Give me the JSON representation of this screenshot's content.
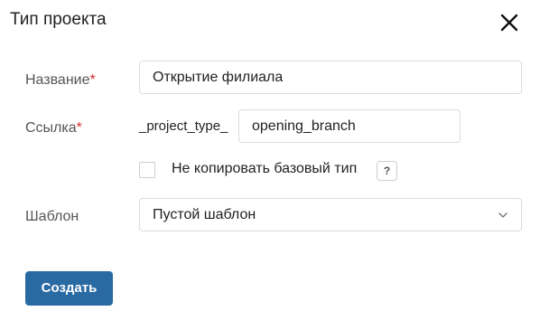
{
  "dialog": {
    "title": "Тип проекта",
    "close_icon": "close-icon"
  },
  "form": {
    "name": {
      "label": "Название",
      "required_mark": "*",
      "value": "Открытие филиала"
    },
    "link": {
      "label": "Ссылка",
      "required_mark": "*",
      "prefix": "_project_type_",
      "value": "opening_branch"
    },
    "no_copy_base_type": {
      "label": "Не копировать базовый тип",
      "checked": false,
      "help_icon": "?"
    },
    "template": {
      "label": "Шаблон",
      "selected": "Пустой шаблон",
      "icon": "chevron-down-icon"
    }
  },
  "actions": {
    "create_label": "Создать"
  },
  "colors": {
    "primary": "#2a6aa3",
    "required": "#d32f2f",
    "border": "#d7dbe0"
  }
}
